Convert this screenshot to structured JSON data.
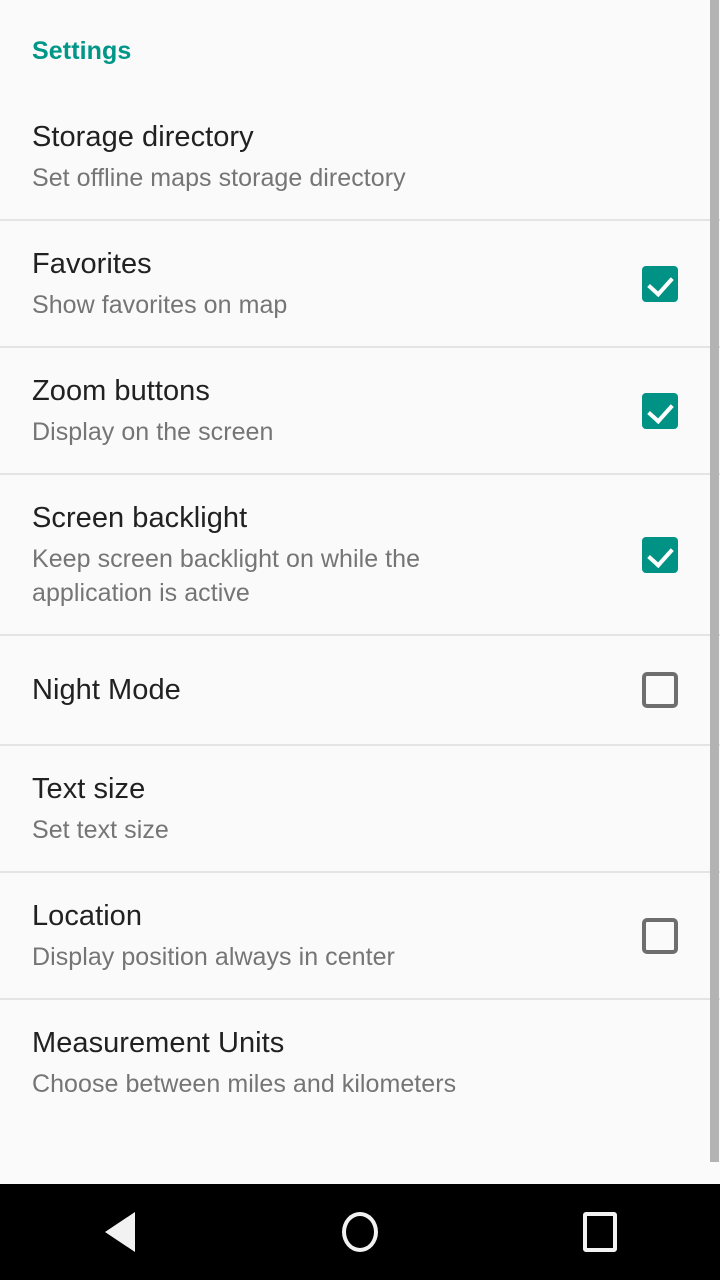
{
  "screen": {
    "background_color": "#fafafa",
    "accent_color": "#009688",
    "divider_color": "#e4e4e4",
    "title_color": "#212121",
    "summary_color": "#757575"
  },
  "section": {
    "header": "Settings"
  },
  "preferences": [
    {
      "title": "Storage directory",
      "summary": "Set offline maps storage directory",
      "widget": "none",
      "checked": null
    },
    {
      "title": "Favorites",
      "summary": "Show favorites on map",
      "widget": "checkbox",
      "checked": true
    },
    {
      "title": "Zoom buttons",
      "summary": "Display on the screen",
      "widget": "checkbox",
      "checked": true
    },
    {
      "title": "Screen backlight",
      "summary": "Keep screen backlight on while the application is active",
      "widget": "checkbox",
      "checked": true
    },
    {
      "title": "Night Mode",
      "summary": "",
      "widget": "checkbox",
      "checked": false
    },
    {
      "title": "Text size",
      "summary": "Set text size",
      "widget": "none",
      "checked": null
    },
    {
      "title": "Location",
      "summary": "Display position always in center",
      "widget": "checkbox",
      "checked": false
    },
    {
      "title": "Measurement Units",
      "summary": "Choose between miles and kilometers",
      "widget": "none",
      "checked": null
    }
  ],
  "navbar": {
    "back_label": "Back",
    "home_label": "Home",
    "recents_label": "Recents"
  }
}
